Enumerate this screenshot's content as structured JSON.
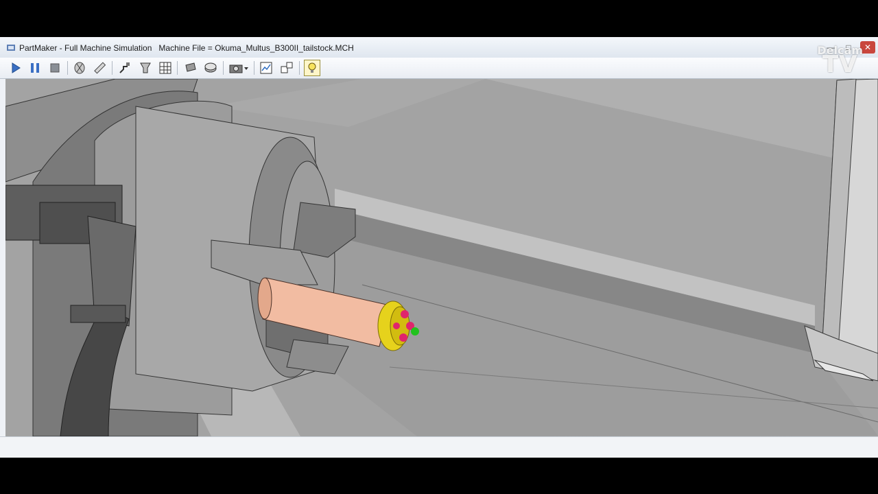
{
  "window": {
    "title": "PartMaker - Full Machine Simulation   Machine File = Okuma_Multus_B300II_tailstock.MCH"
  },
  "watermark": {
    "line1": "Delcam",
    "line2": "TV"
  },
  "toolbar": {
    "buttons": [
      {
        "name": "play-button",
        "icon": "play-icon"
      },
      {
        "name": "pause-button",
        "icon": "pause-icon"
      },
      {
        "name": "stop-button",
        "icon": "stop-icon"
      },
      {
        "name": "view-part-button",
        "icon": "part-view-icon"
      },
      {
        "name": "measure-button",
        "icon": "ruler-icon"
      },
      {
        "name": "tool-path-button",
        "icon": "tool-path-icon"
      },
      {
        "name": "tool-holder-button",
        "icon": "tool-holder-icon"
      },
      {
        "name": "grid-button",
        "icon": "grid-icon"
      },
      {
        "name": "stock-button",
        "icon": "stock-icon"
      },
      {
        "name": "fixture-button",
        "icon": "fixture-icon"
      },
      {
        "name": "camera-dropdown-button",
        "icon": "camera-icon"
      },
      {
        "name": "report-button",
        "icon": "chart-icon"
      },
      {
        "name": "windows-button",
        "icon": "windows-icon"
      },
      {
        "name": "lighting-button",
        "icon": "bulb-icon",
        "active": true
      }
    ]
  },
  "colors": {
    "background": "#9b9b9b",
    "part": "#f2bca2",
    "tool": "#e6d21c",
    "insert": "#e0256c",
    "cut": "#22c21e"
  }
}
